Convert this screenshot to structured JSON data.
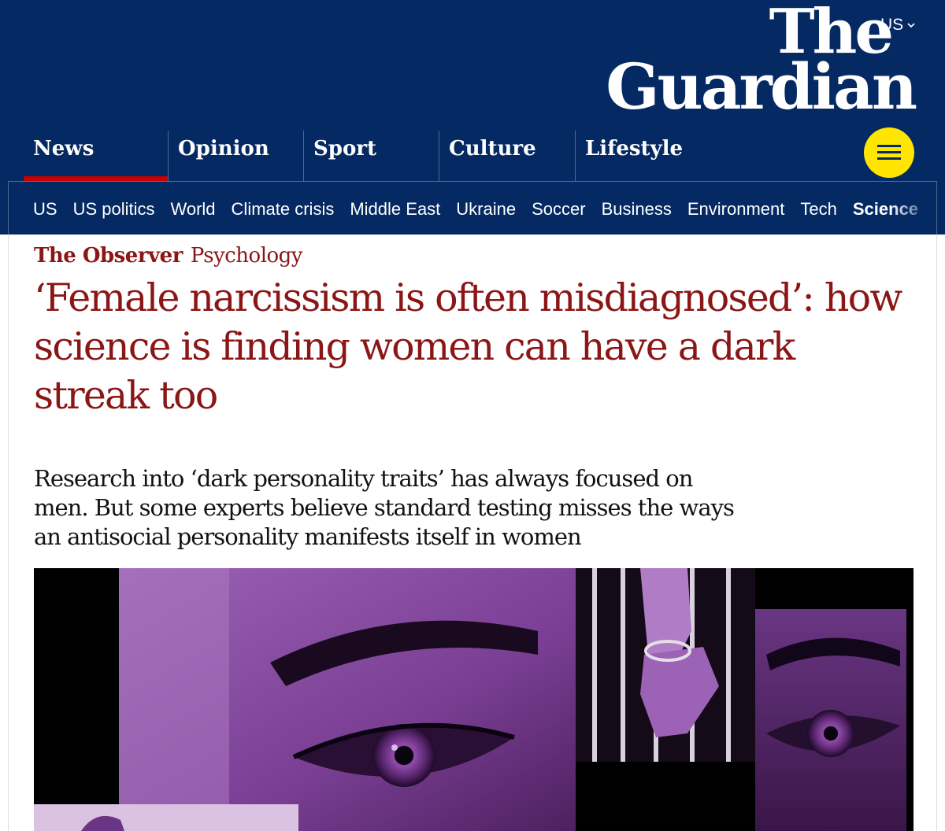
{
  "header": {
    "edition": "US",
    "logo": {
      "line1": "The",
      "line2": "Guardian"
    },
    "pillars": [
      {
        "label": "News",
        "active": true
      },
      {
        "label": "Opinion",
        "active": false
      },
      {
        "label": "Sport",
        "active": false
      },
      {
        "label": "Culture",
        "active": false
      },
      {
        "label": "Lifestyle",
        "active": false
      }
    ],
    "subnav": [
      "US",
      "US politics",
      "World",
      "Climate crisis",
      "Middle East",
      "Ukraine",
      "Soccer",
      "Business",
      "Environment",
      "Tech",
      "Science"
    ],
    "colors": {
      "brand": "#052962",
      "accent": "#c70000",
      "menu": "#ffe500"
    }
  },
  "article": {
    "series": "The Observer",
    "section": "Psychology",
    "headline": "‘Female narcissism is often misdiagnosed’: how science is finding women can have a dark streak too",
    "standfirst": "Research into ‘dark personality traits’ has always focused on men. But some experts believe standard testing misses the ways an antisocial personality manifests itself in women",
    "colors": {
      "headline": "#8b1616"
    },
    "image": {
      "description_icon": "collage-photo"
    }
  }
}
